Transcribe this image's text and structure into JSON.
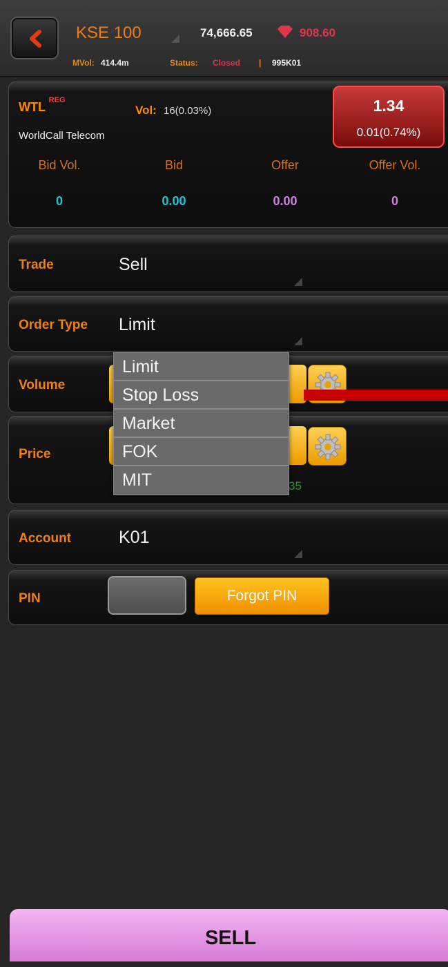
{
  "header": {
    "index_name": "KSE 100",
    "index_value": "74,666.65",
    "index_change": "908.60",
    "mvol_label": "MVol:",
    "mvol_value": "414.4m",
    "status_label": "Status:",
    "status_value": "Closed",
    "separator": "|",
    "account_code": "995K01",
    "back_icon": "chevron-left-icon",
    "trend_icon": "diamond-down-icon"
  },
  "quote": {
    "symbol": "WTL",
    "market": "REG",
    "vol_label": "Vol:",
    "vol_value": "16(0.03%)",
    "company": "WorldCall Telecom",
    "last_price": "1.34",
    "change": "0.01(0.74%)",
    "columns": [
      "Bid Vol.",
      "Bid",
      "Offer",
      "Offer Vol."
    ],
    "values": [
      "0",
      "0.00",
      "0.00",
      "0"
    ]
  },
  "form": {
    "trade_label": "Trade",
    "trade_value": "Sell",
    "order_type_label": "Order Type",
    "order_type_value": "Limit",
    "volume_label": "Volume",
    "price_label": "Price",
    "price_hint_fragment": "35",
    "account_label": "Account",
    "account_value": "K01",
    "pin_label": "PIN",
    "pin_value": "",
    "forgot_pin_label": "Forgot PIN"
  },
  "dropdown": {
    "options": [
      "Limit",
      "Stop Loss",
      "Market",
      "FOK",
      "MIT"
    ]
  },
  "footer": {
    "sell_label": "SELL"
  },
  "colors": {
    "accent": "#f08010",
    "sell_price_box": "#a81f1f",
    "bid_color": "#21c4d4",
    "offer_color": "#d67ee6",
    "sell_button": "#e59be4"
  }
}
